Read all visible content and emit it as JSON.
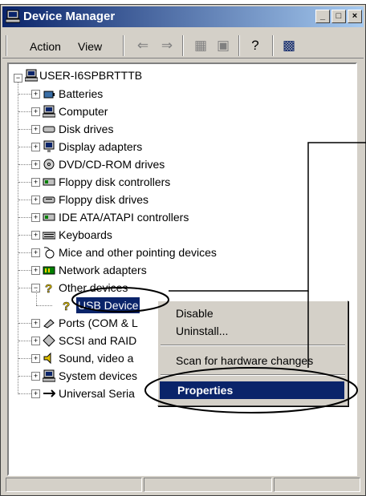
{
  "window": {
    "title": "Device Manager"
  },
  "menu": {
    "action": "Action",
    "view": "View"
  },
  "tree": {
    "root": "USER-I6SPBRTTTB",
    "items": [
      {
        "label": "Batteries",
        "icon": "battery-icon"
      },
      {
        "label": "Computer",
        "icon": "computer-icon"
      },
      {
        "label": "Disk drives",
        "icon": "disk-drive-icon"
      },
      {
        "label": "Display adapters",
        "icon": "monitor-icon"
      },
      {
        "label": "DVD/CD-ROM drives",
        "icon": "cdrom-icon"
      },
      {
        "label": "Floppy disk controllers",
        "icon": "controller-icon"
      },
      {
        "label": "Floppy disk drives",
        "icon": "floppy-icon"
      },
      {
        "label": "IDE ATA/ATAPI controllers",
        "icon": "controller-icon"
      },
      {
        "label": "Keyboards",
        "icon": "keyboard-icon"
      },
      {
        "label": "Mice and other pointing devices",
        "icon": "mouse-icon"
      },
      {
        "label": "Network adapters",
        "icon": "network-icon"
      },
      {
        "label": "Other devices",
        "icon": "question-icon"
      },
      {
        "label": "USB Device",
        "icon": "question-icon"
      },
      {
        "label": "Ports (COM & L",
        "icon": "port-icon"
      },
      {
        "label": "SCSI and RAID",
        "icon": "scsi-icon"
      },
      {
        "label": "Sound, video a",
        "icon": "sound-icon"
      },
      {
        "label": "System devices",
        "icon": "computer-icon"
      },
      {
        "label": "Universal Seria",
        "icon": "usb-icon"
      }
    ]
  },
  "context_menu": {
    "disable": "Disable",
    "uninstall": "Uninstall...",
    "scan": "Scan for hardware changes",
    "properties": "Properties"
  },
  "colors": {
    "titlebar": "#0a246a",
    "selection": "#0a246a",
    "chrome": "#d4d0c8"
  }
}
